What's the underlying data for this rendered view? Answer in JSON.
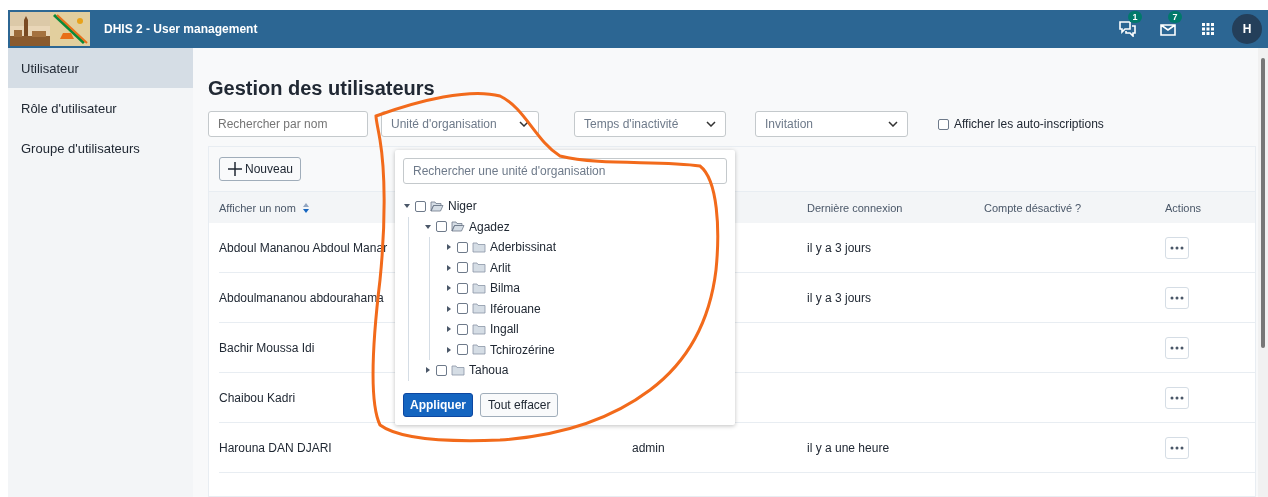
{
  "header": {
    "title": "DHIS 2 - User management",
    "interpretations_badge": "1",
    "messages_badge": "7",
    "avatar": "H"
  },
  "sidebar": {
    "items": [
      {
        "label": "Utilisateur",
        "selected": true
      },
      {
        "label": "Rôle d'utilisateur",
        "selected": false
      },
      {
        "label": "Groupe d'utilisateurs",
        "selected": false
      }
    ]
  },
  "page_title": "Gestion des utilisateurs",
  "filters": {
    "search_placeholder": "Rechercher par nom",
    "org_unit": "Unité d'organisation",
    "inactivity": "Temps d'inactivité",
    "invitation": "Invitation",
    "self_registered": {
      "label": "Afficher les auto-inscriptions",
      "checked": false
    }
  },
  "table": {
    "new_button": "Nouveau",
    "columns": [
      {
        "label": "Afficher un nom",
        "sortable": true
      },
      {
        "label": "Dernière connexion",
        "sortable": false
      },
      {
        "label": "Compte désactivé ?",
        "sortable": false
      },
      {
        "label": "Actions",
        "sortable": false
      }
    ],
    "rows": [
      {
        "name": "Abdoul Mananou Abdoul Manar",
        "column_2": null,
        "last_login": "il y a 3 jours"
      },
      {
        "name": "Abdoulmananou abdourahama",
        "column_2": null,
        "last_login": "il y a 3 jours"
      },
      {
        "name": "Bachir Moussa Idi",
        "column_2": null,
        "last_login": null
      },
      {
        "name": "Chaibou Kadri",
        "column_2": null,
        "last_login": null
      },
      {
        "name": "Harouna DAN DJARI",
        "column_2": "admin",
        "last_login": "il y a une heure"
      }
    ]
  },
  "org_unit_popup": {
    "search_placeholder": "Rechercher une unité d'organisation",
    "tree": [
      {
        "label": "Niger",
        "expanded": true,
        "checked": false,
        "children": [
          {
            "label": "Agadez",
            "expanded": true,
            "checked": false,
            "children": [
              {
                "label": "Aderbissinat",
                "expanded": false,
                "checked": false
              },
              {
                "label": "Arlit",
                "expanded": false,
                "checked": false
              },
              {
                "label": "Bilma",
                "expanded": false,
                "checked": false
              },
              {
                "label": "Iférouane",
                "expanded": false,
                "checked": false
              },
              {
                "label": "Ingall",
                "expanded": false,
                "checked": false
              },
              {
                "label": "Tchirozérine",
                "expanded": false,
                "checked": false
              }
            ]
          },
          {
            "label": "Tahoua",
            "expanded": false,
            "checked": false
          }
        ]
      }
    ],
    "apply_button": "Appliquer",
    "clear_button": "Tout effacer"
  }
}
